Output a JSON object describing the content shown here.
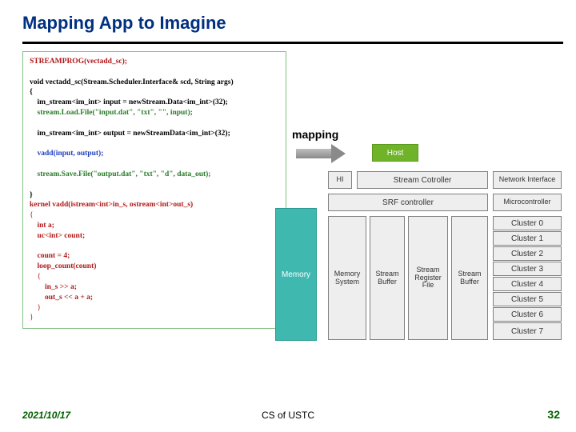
{
  "title": "Mapping App to Imagine",
  "mapping_label": "mapping",
  "code": {
    "l1": "STREAMPROG(vectadd_sc);",
    "l2": "void vectadd_sc(Stream.Scheduler.Interface& scd, String args)",
    "l3": "{",
    "l4": "    im_stream<im_int> input = newStream.Data<im_int>(32);",
    "l5": "    stream.Load.File(\"input.dat\", \"txt\", \"\", input);",
    "l6": "    im_stream<im_int> output = newStreamData<im_int>(32);",
    "l7": "    vadd(input, output);",
    "l8": "    stream.Save.File(\"output.dat\", \"txt\", \"d\", data_out);",
    "l9": "}",
    "l10": "kernel vadd(istream<int>in_s, ostream<int>out_s)",
    "l11": "{",
    "l12": "    int a;",
    "l13": "    uc<int> count;",
    "l14": "    count = 4;",
    "l15": "    loop_count(count)",
    "l16": "    {",
    "l17": "        in_s >> a;",
    "l18": "        out_s << a + a;",
    "l19": "    }",
    "l20": "}"
  },
  "diagram": {
    "memory": "Memory",
    "host": "Host",
    "hi": "HI",
    "stream_controller": "Stream Cotroller",
    "network_interface": "Network Interface",
    "srf_controller": "SRF controller",
    "microcontroller": "Microcontroller",
    "memsys": "Memory\nSystem",
    "stream_buffer": "Stream\nBuffer",
    "srf": "Stream\nRegister\nFile",
    "stream_buffer2": "Stream\nBuffer",
    "clusters": [
      "Cluster 0",
      "Cluster 1",
      "Cluster 2",
      "Cluster 3",
      "Cluster 4",
      "Cluster 5",
      "Cluster 6",
      "Cluster 7"
    ]
  },
  "footer": {
    "date": "2021/10/17",
    "center": "CS of USTC",
    "page": "32"
  }
}
